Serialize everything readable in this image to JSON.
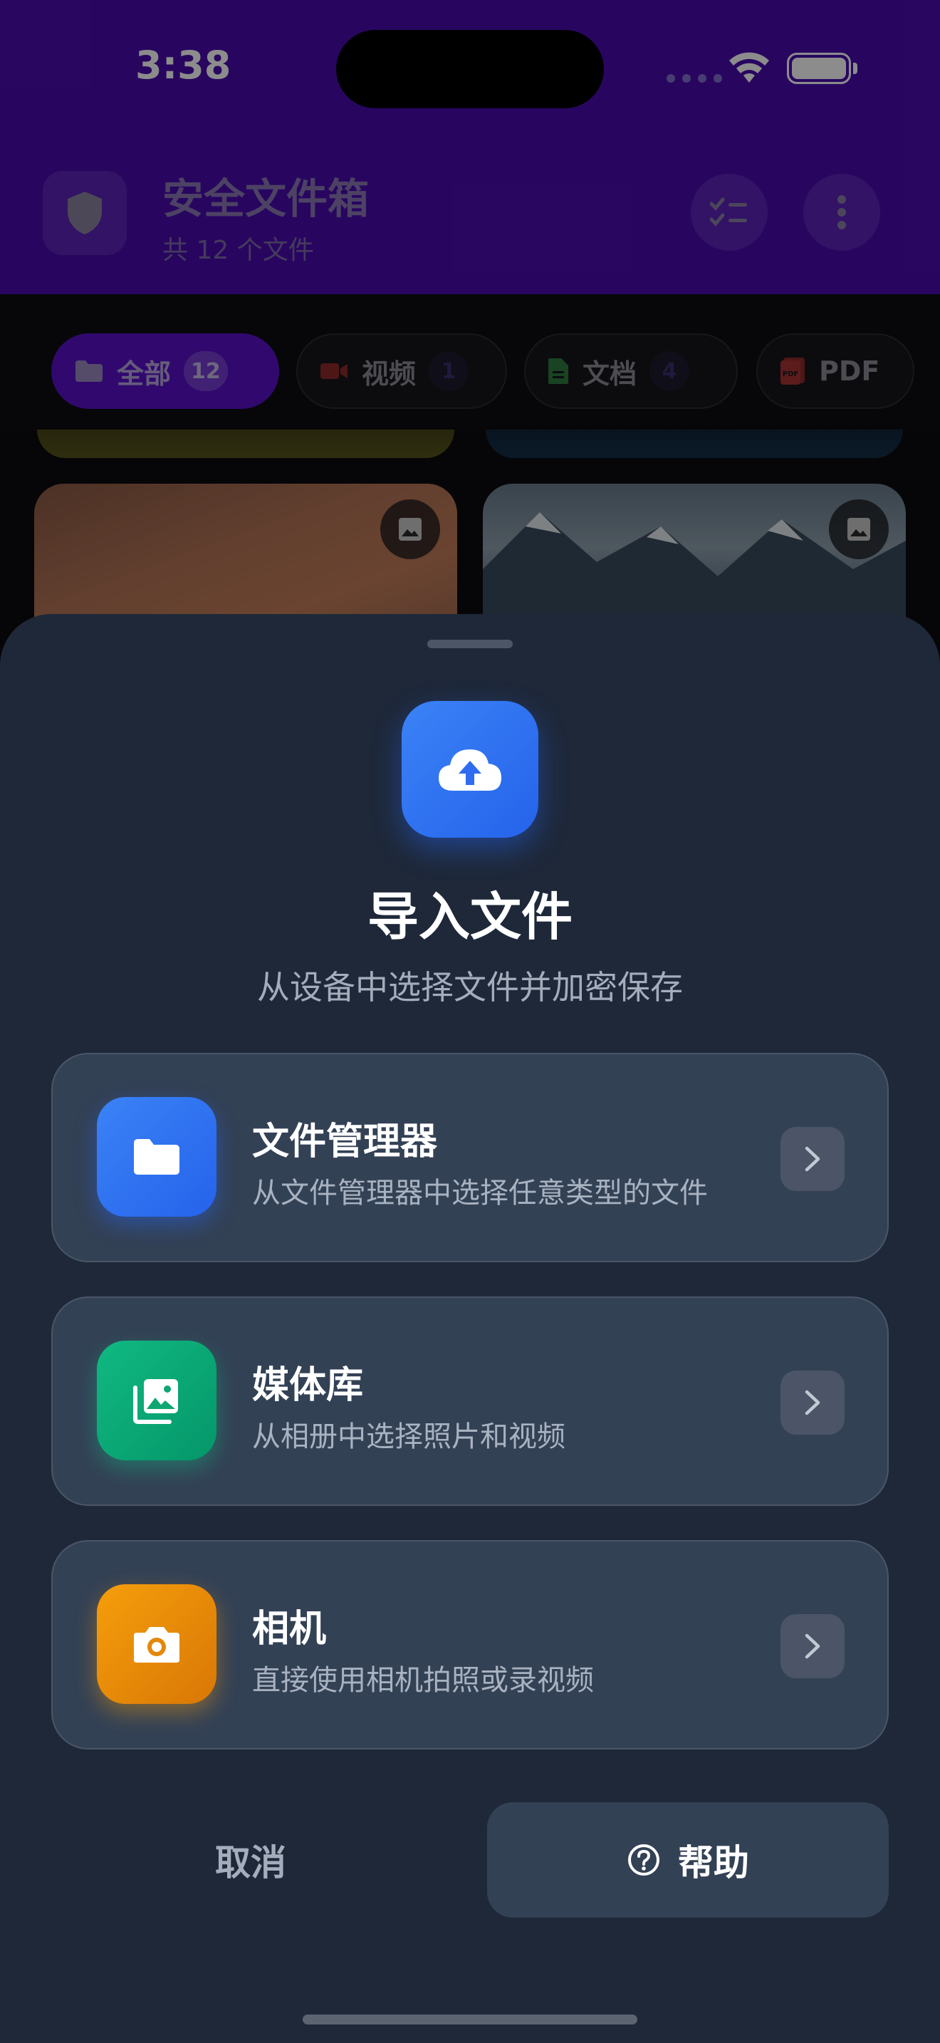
{
  "status_bar": {
    "time": "3:38"
  },
  "header": {
    "title": "安全文件箱",
    "subtitle": "共 12 个文件"
  },
  "filters": [
    {
      "label": "全部",
      "count": "12",
      "icon": "folder-icon",
      "active": true
    },
    {
      "label": "视频",
      "count": "1",
      "icon": "video-icon",
      "active": false
    },
    {
      "label": "文档",
      "count": "4",
      "icon": "document-icon",
      "active": false
    },
    {
      "label": "PDF",
      "count": "",
      "icon": "pdf-icon",
      "active": false
    }
  ],
  "sheet": {
    "title": "导入文件",
    "subtitle": "从设备中选择文件并加密保存",
    "options": [
      {
        "title": "文件管理器",
        "desc": "从文件管理器中选择任意类型的文件",
        "icon": "folder-icon",
        "color": "#3b82f6"
      },
      {
        "title": "媒体库",
        "desc": "从相册中选择照片和视频",
        "icon": "photo-library-icon",
        "color": "#10b981"
      },
      {
        "title": "相机",
        "desc": "直接使用相机拍照或录视频",
        "icon": "camera-icon",
        "color": "#f59e0b"
      }
    ],
    "cancel_label": "取消",
    "help_label": "帮助"
  },
  "colors": {
    "header_bg": "#4a0cb0",
    "sheet_bg": "#1e2839",
    "card_bg": "#334155",
    "accent_blue": "#3b82f6"
  }
}
